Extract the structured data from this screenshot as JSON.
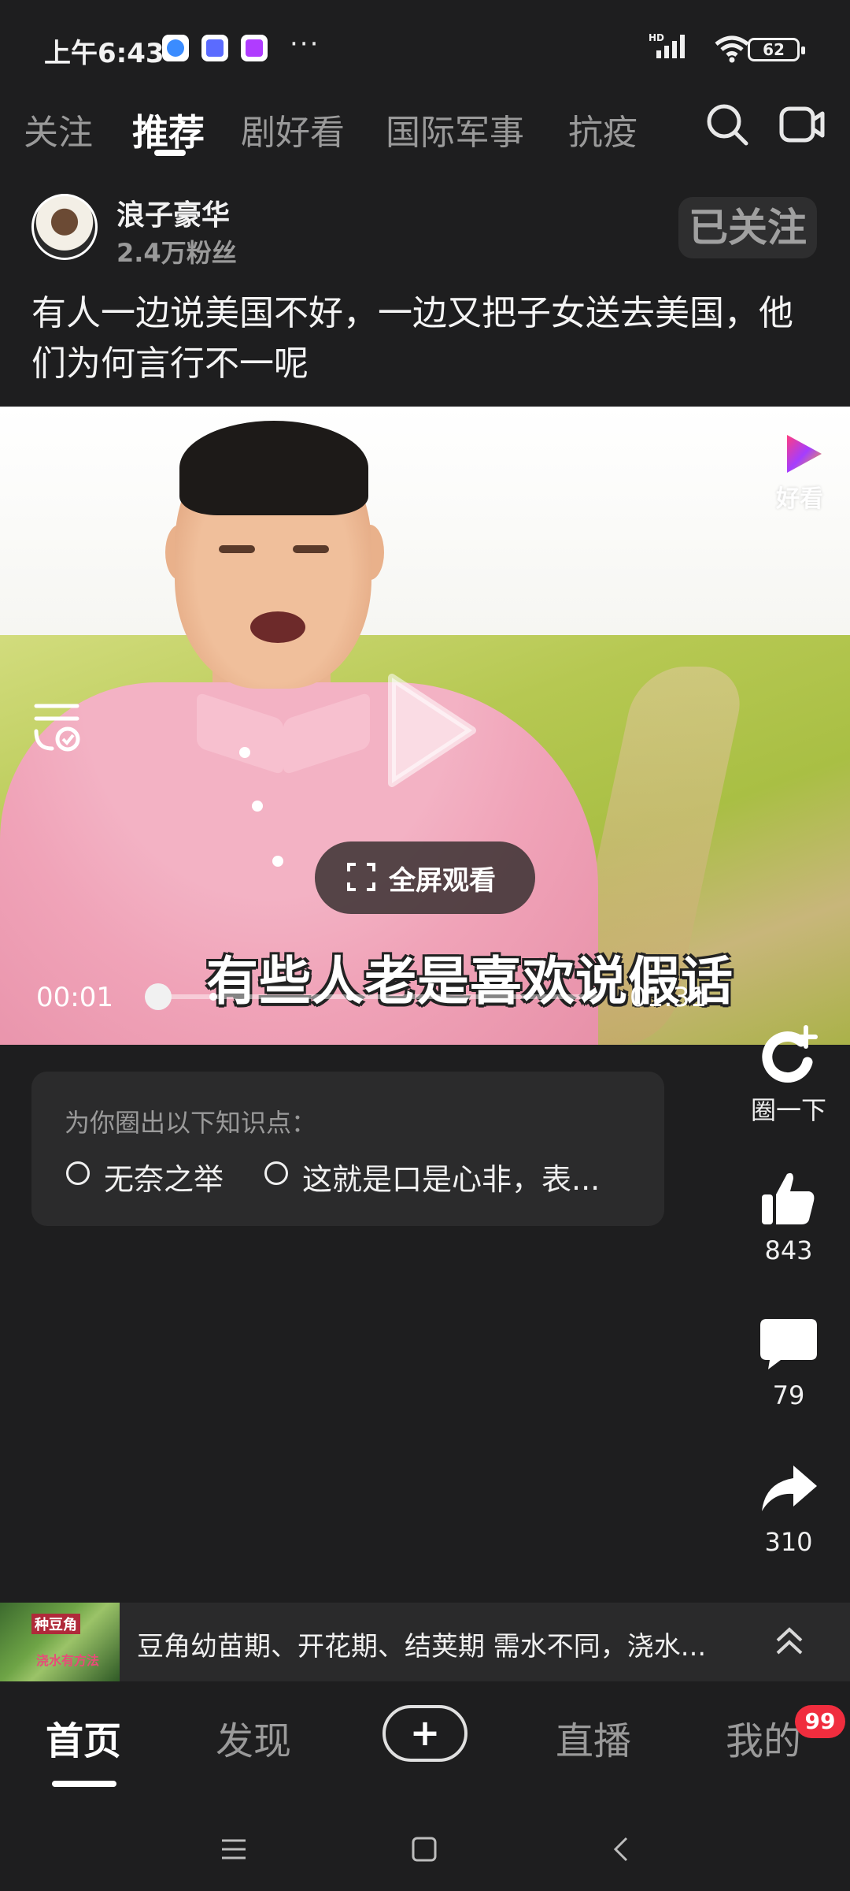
{
  "status_bar": {
    "time": "上午6:43",
    "more": "···",
    "signal": "HD",
    "battery": "62"
  },
  "tabs": [
    {
      "label": "关注",
      "active": false
    },
    {
      "label": "推荐",
      "active": true
    },
    {
      "label": "剧好看",
      "active": false
    },
    {
      "label": "国际军事",
      "active": false
    },
    {
      "label": "抗疫",
      "active": false
    }
  ],
  "author": {
    "name": "浪子豪华",
    "fans": "2.4万粉丝",
    "follow_label": "已关注"
  },
  "video": {
    "title": "有人一边说美国不好，一边又把子女送去美国，他们为何言行不一呢",
    "brand": "好看",
    "fullscreen_label": "全屏观看",
    "subtitle": "有些人老是喜欢说假话",
    "current_time": "00:01",
    "total_time": "01:31",
    "progress": 0.01
  },
  "knowledge": {
    "heading": "为你圈出以下知识点：",
    "items": [
      "无奈之举",
      "这就是口是心非，表..."
    ]
  },
  "actions": {
    "circle_label": "圈一下",
    "likes": "843",
    "comments": "79",
    "shares": "310"
  },
  "mini_bar": {
    "thumb_text1": "种豆角",
    "thumb_text2": "浇水有方法",
    "text": "豆角幼苗期、开花期、结荚期 需水不同，浇水..."
  },
  "bottom_nav": {
    "home": "首页",
    "discover": "发现",
    "add": "+",
    "live": "直播",
    "mine": "我的",
    "badge": "99"
  },
  "colors": {
    "background": "#1e1e1f",
    "badge": "#f02d3e",
    "card": "#2b2b2c"
  }
}
